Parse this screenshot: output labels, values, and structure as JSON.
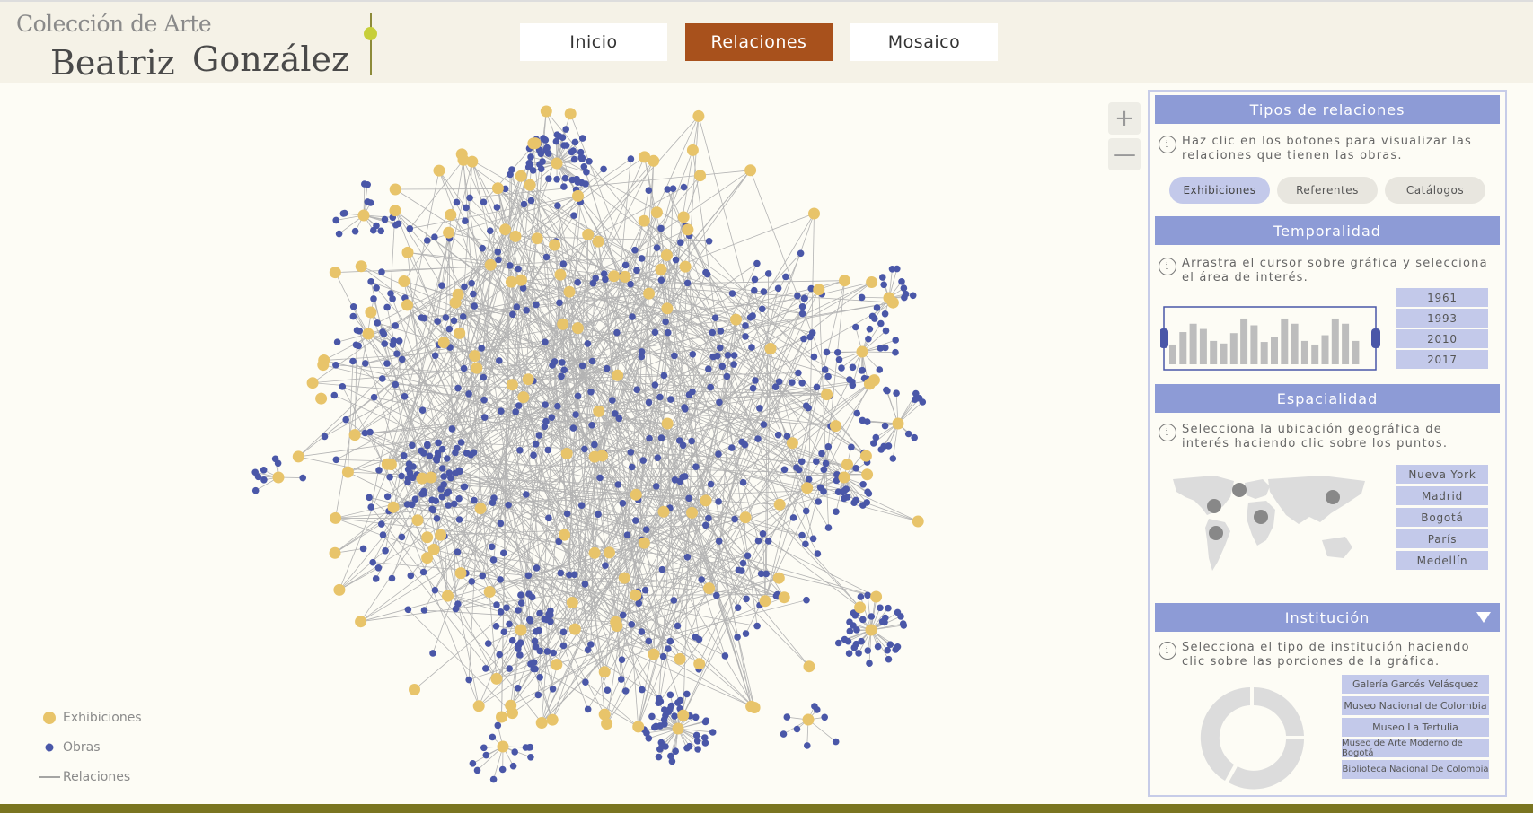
{
  "header": {
    "brand_top": "Colección de Arte",
    "brand_first": "Beatriz",
    "brand_last": "González",
    "nav": [
      {
        "label": "Inicio",
        "active": false
      },
      {
        "label": "Relaciones",
        "active": true
      },
      {
        "label": "Mosaico",
        "active": false
      }
    ]
  },
  "graph": {
    "zoom_in": "+",
    "zoom_out": "—",
    "legend": [
      {
        "label": "Exhibiciones",
        "symbol": "yellow-dot"
      },
      {
        "label": "Obras",
        "symbol": "blue-dot"
      },
      {
        "label": "Relaciones",
        "symbol": "line"
      }
    ]
  },
  "panel": {
    "tipos": {
      "title": "Tipos de relaciones",
      "info": "Haz clic en los botones para visualizar las relaciones que tienen las obras.",
      "buttons": [
        {
          "label": "Exhibiciones",
          "active": true
        },
        {
          "label": "Referentes",
          "active": false
        },
        {
          "label": "Catálogos",
          "active": false
        }
      ]
    },
    "temporalidad": {
      "title": "Temporalidad",
      "info": "Arrastra el cursor sobre gráfica y selecciona el área de interés.",
      "years": [
        "1961",
        "1993",
        "2010",
        "2017"
      ],
      "histogram": [
        0.38,
        0.62,
        0.78,
        0.68,
        0.45,
        0.4,
        0.6,
        0.88,
        0.75,
        0.43,
        0.52,
        0.88,
        0.78,
        0.45,
        0.38,
        0.56,
        0.88,
        0.78,
        0.45
      ]
    },
    "espacialidad": {
      "title": "Espacialidad",
      "info": "Selecciona la ubicación geográfica de interés haciendo clic sobre los puntos.",
      "cities": [
        "Nueva York",
        "Madrid",
        "Bogotá",
        "París",
        "Medellín"
      ]
    },
    "institucion": {
      "title": "Institución",
      "info": "Selecciona el tipo de institución haciendo clic sobre las porciones de la gráfica.",
      "institutions": [
        "Galería Garcés Velásquez",
        "Museo Nacional de Colombia",
        "Museo La Tertulia",
        "Museo de Arte Moderno de Bogotá",
        "Biblioteca Nacional De Colombia"
      ]
    }
  },
  "colors": {
    "exhibition": "#e8c46a",
    "obra": "#4a57a8",
    "edge": "#b3b3b3",
    "accent": "#a8511c",
    "panel_header": "#8d9bd6"
  }
}
